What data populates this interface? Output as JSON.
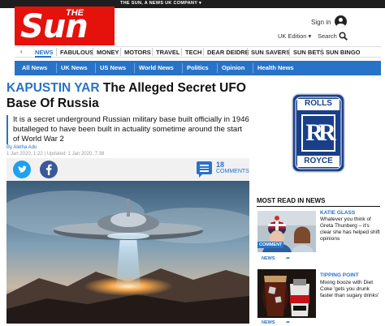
{
  "masthead": {
    "tagline": "THE SUN, A NEWS UK COMPANY ▾",
    "logo_the": "THE",
    "logo_sun": "Sun",
    "sign_in": "Sign in",
    "edition": "UK Edition ▾",
    "search": "Search"
  },
  "nav_primary": [
    "NEWS",
    "FABULOUS",
    "MONEY",
    "MOTORS",
    "TRAVEL",
    "TECH",
    "DEAR DEIDRE",
    "SUN SAVERS",
    "SUN BETS",
    "SUN BINGO"
  ],
  "nav_secondary": [
    "All News",
    "UK News",
    "US News",
    "World News",
    "Politics",
    "Opinion",
    "Health News"
  ],
  "article": {
    "kicker": "KAPUSTIN YAR",
    "headline": "The Alleged Secret UFO Base Of Russia",
    "standfirst": "It is a secret underground Russian military base built officially in 1946 butalleged to have been built in actuality sometime around the start of World War 2",
    "byline": "By Aletha Adu",
    "timestamp": "1 Jan 2020, 1:22 | Updated: 1 Jan 2020, 7:38",
    "comments_count": "18",
    "comments_label": "COMMENTS"
  },
  "ad": {
    "brand_top": "ROLLS",
    "brand_bottom": "ROYCE",
    "monogram": "RR"
  },
  "most_read": {
    "title": "MOST READ IN NEWS",
    "items": [
      {
        "kicker": "KATIE GLASS",
        "teaser": "Whatever you think of Greta Thunberg – it's clear she has helped shift opinions",
        "badge": "COMMENT",
        "link": "NEWS"
      },
      {
        "kicker": "TIPPING POINT",
        "teaser": "Mixing booze with Diet Coke 'gets you drunk faster than sugary drinks'",
        "link": "NEWS"
      }
    ]
  },
  "colors": {
    "brand_red": "#e4120a",
    "accent_blue": "#2873c8"
  }
}
